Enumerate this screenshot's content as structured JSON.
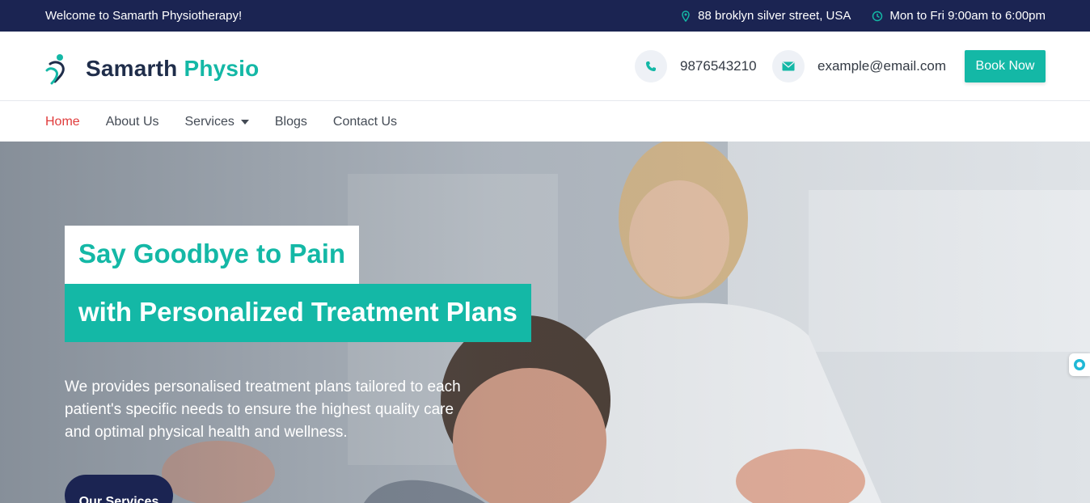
{
  "topbar": {
    "welcome": "Welcome to Samarth Physiotherapy!",
    "address": "88 broklyn silver street, USA",
    "hours": "Mon to Fri 9:00am to 6:00pm"
  },
  "header": {
    "logo_primary": "Samarth",
    "logo_accent": "Physio",
    "phone": "9876543210",
    "email": "example@email.com",
    "book_label": "Book Now"
  },
  "nav": {
    "items": [
      {
        "label": "Home",
        "active": true
      },
      {
        "label": "About Us"
      },
      {
        "label": "Services",
        "has_dropdown": true
      },
      {
        "label": "Blogs"
      },
      {
        "label": "Contact Us"
      }
    ]
  },
  "hero": {
    "title_line1": "Say Goodbye to Pain",
    "title_line2": "with Personalized Treatment Plans",
    "description": "We provides personalised treatment plans tailored to each patient's specific needs to ensure the highest quality care and optimal physical health and wellness.",
    "cta_label": "Our Services"
  },
  "colors": {
    "navy": "#1b2452",
    "teal": "#14b8a6",
    "active_red": "#e03b3b"
  },
  "icons": [
    "location-pin-icon",
    "clock-icon",
    "logo-person-icon",
    "phone-icon",
    "mail-icon",
    "chat-widget-icon",
    "caret-down-icon"
  ]
}
